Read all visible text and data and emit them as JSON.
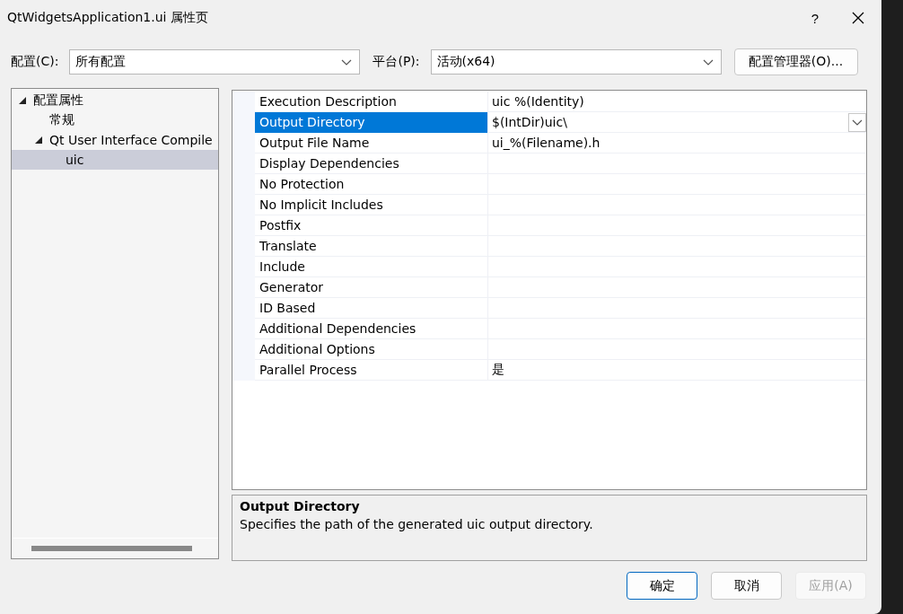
{
  "window": {
    "title": "QtWidgetsApplication1.ui 属性页",
    "help": "?"
  },
  "config": {
    "label": "配置(C):",
    "value": "所有配置"
  },
  "platform": {
    "label": "平台(P):",
    "value": "活动(x64)"
  },
  "manager_button": "配置管理器(O)...",
  "tree": [
    {
      "label": "配置属性",
      "expanded": true,
      "selected": false,
      "children": [
        {
          "label": "常规",
          "selected": false
        },
        {
          "label": "Qt User Interface Compile",
          "expanded": true,
          "selected": false,
          "children": [
            {
              "label": "uic",
              "selected": true
            }
          ]
        }
      ]
    }
  ],
  "properties": [
    {
      "name": "Execution Description",
      "value": "uic %(Identity)",
      "selected": false
    },
    {
      "name": "Output Directory",
      "value": "$(IntDir)uic\\",
      "selected": true
    },
    {
      "name": "Output File Name",
      "value": "ui_%(Filename).h",
      "selected": false
    },
    {
      "name": "Display Dependencies",
      "selected": false
    },
    {
      "name": "No Protection",
      "selected": false
    },
    {
      "name": "No Implicit Includes",
      "selected": false
    },
    {
      "name": "Postfix",
      "selected": false
    },
    {
      "name": "Translate",
      "selected": false
    },
    {
      "name": "Include",
      "selected": false
    },
    {
      "name": "Generator",
      "selected": false
    },
    {
      "name": "ID Based",
      "selected": false
    },
    {
      "name": "Additional Dependencies",
      "selected": false
    },
    {
      "name": "Additional Options",
      "selected": false
    },
    {
      "name": "Parallel Process",
      "value": "是",
      "selected": false
    }
  ],
  "description": {
    "title": "Output Directory",
    "text": "Specifies the path of the generated uic output directory."
  },
  "buttons": [
    {
      "label": "确定",
      "kind": "default",
      "disabled": false
    },
    {
      "label": "取消",
      "kind": "normal",
      "disabled": false
    },
    {
      "label": "应用(A)",
      "kind": "normal",
      "disabled": true
    }
  ]
}
